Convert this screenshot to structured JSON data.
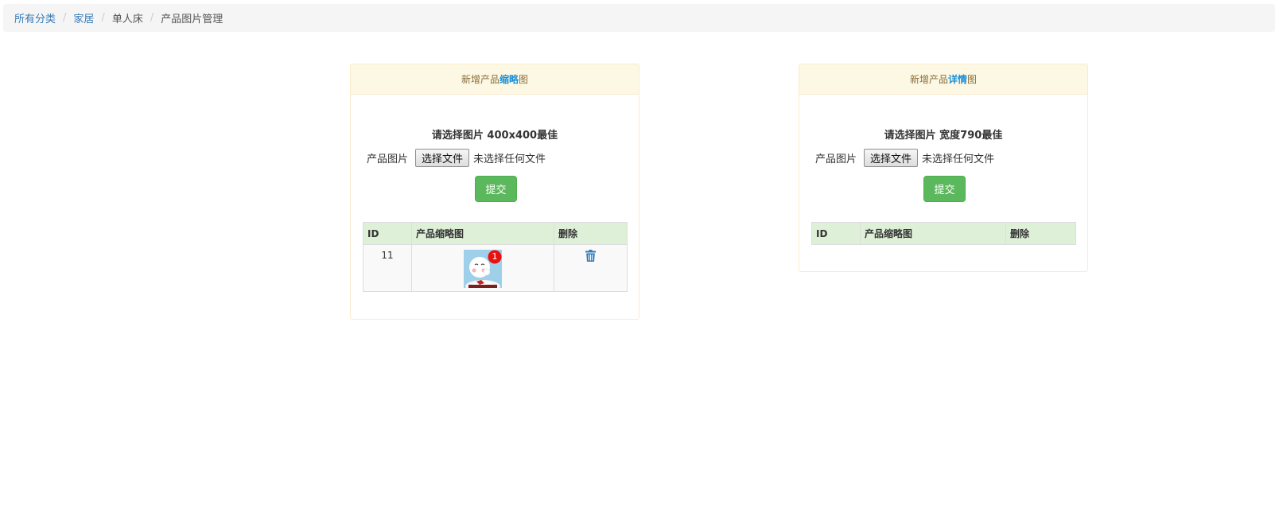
{
  "breadcrumb": {
    "items": [
      {
        "label": "所有分类",
        "link": true
      },
      {
        "label": "家居",
        "link": true
      },
      {
        "label": "单人床",
        "link": false
      },
      {
        "label": "产品图片管理",
        "link": false
      }
    ],
    "separator": "/"
  },
  "panels": [
    {
      "title_prefix": "新增产品",
      "title_highlight": "缩略",
      "title_suffix": "图",
      "hint": "请选择图片 400x400最佳",
      "file_label": "产品图片",
      "file_button": "选择文件",
      "file_status": "未选择任何文件",
      "submit_label": "提交",
      "table_headers": [
        "ID",
        "产品缩略图",
        "删除"
      ],
      "rows": [
        {
          "id": "11",
          "badge": "1"
        }
      ]
    },
    {
      "title_prefix": "新增产品",
      "title_highlight": "详情",
      "title_suffix": "图",
      "hint": "请选择图片 宽度790最佳",
      "file_label": "产品图片",
      "file_button": "选择文件",
      "file_status": "未选择任何文件",
      "submit_label": "提交",
      "table_headers": [
        "ID",
        "产品缩略图",
        "删除"
      ],
      "rows": []
    }
  ],
  "icons": {
    "delete": "trash-icon",
    "thumbnail": "cartoon-thumbnail-image"
  },
  "colors": {
    "link": "#337ab7",
    "panel_border": "#faebcc",
    "panel_heading_bg": "#fcf8e3",
    "highlight": "#1a8fd9",
    "submit": "#5cb85c",
    "table_header_bg": "#dff0d8",
    "badge": "#e8110f"
  }
}
